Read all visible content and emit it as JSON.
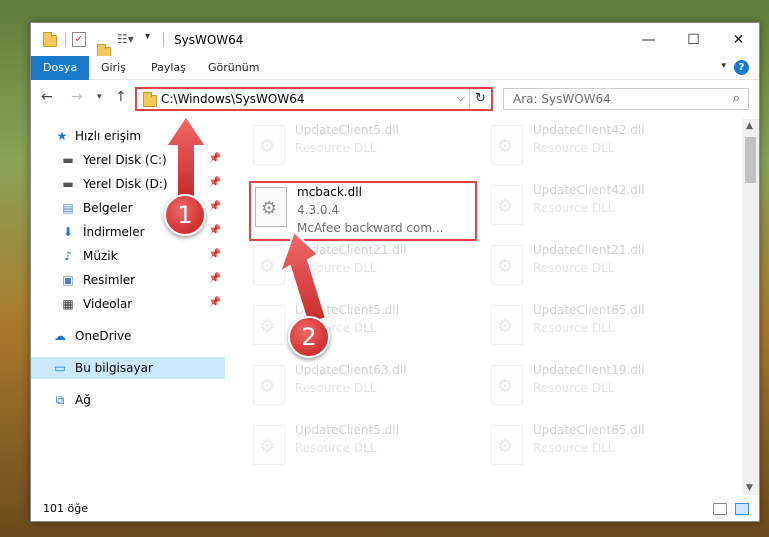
{
  "window": {
    "title": "SysWOW64"
  },
  "ribbon": {
    "tabs": [
      {
        "label": "Dosya"
      },
      {
        "label": "Giriş"
      },
      {
        "label": "Paylaş"
      },
      {
        "label": "Görünüm"
      }
    ],
    "help": "?"
  },
  "address": {
    "path": "C:\\Windows\\SysWOW64",
    "search_placeholder": "Ara: SysWOW64"
  },
  "sidebar": {
    "quick_access": "Hızlı erişim",
    "items": [
      {
        "label": "Yerel Disk (C:)"
      },
      {
        "label": "Yerel Disk (D:)"
      },
      {
        "label": "Belgeler"
      },
      {
        "label": "İndirmeler"
      },
      {
        "label": "Müzik"
      },
      {
        "label": "Resimler"
      },
      {
        "label": "Videolar"
      }
    ],
    "onedrive": "OneDrive",
    "this_pc": "Bu bilgisayar",
    "network": "Ağ"
  },
  "files": {
    "left": [
      {
        "name": "UpdateClient5.dll",
        "type": "Resource DLL"
      },
      {
        "name": "mcback.dll",
        "version": "4.3.0.4",
        "desc": "McAfee backward com..."
      },
      {
        "name": "UpdateClient21.dll",
        "type": "Resource DLL"
      },
      {
        "name": "UpdateClient5.dll",
        "type": "Resource DLL"
      },
      {
        "name": "UpdateClient63.dll",
        "type": "Resource DLL"
      },
      {
        "name": "UpdateClient5.dll",
        "type": "Resource DLL"
      }
    ],
    "right": [
      {
        "name": "UpdateClient42.dll",
        "type": "Resource DLL"
      },
      {
        "name": "UpdateClient42.dll",
        "type": "Resource DLL"
      },
      {
        "name": "UpdateClient21.dll",
        "type": "Resource DLL"
      },
      {
        "name": "UpdateClient65.dll",
        "type": "Resource DLL"
      },
      {
        "name": "UpdateClient19.dll",
        "type": "Resource DLL"
      },
      {
        "name": "UpdateClient65.dll",
        "type": "Resource DLL"
      }
    ]
  },
  "status": {
    "count": "101 öğe"
  },
  "callouts": {
    "one": "1",
    "two": "2"
  }
}
